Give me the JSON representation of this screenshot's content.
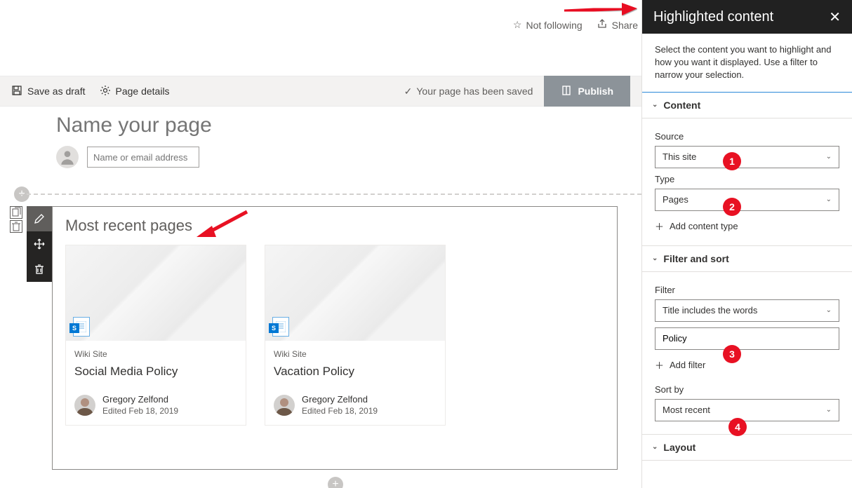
{
  "topbar": {
    "follow": "Not following",
    "share": "Share"
  },
  "commandbar": {
    "save_draft": "Save as draft",
    "page_details": "Page details",
    "saved_msg": "Your page has been saved",
    "publish": "Publish"
  },
  "page": {
    "title_placeholder": "Name your page",
    "author_placeholder": "Name or email address"
  },
  "webpart": {
    "title": "Most recent pages",
    "cards": [
      {
        "site": "Wiki Site",
        "title": "Social Media Policy",
        "author": "Gregory Zelfond",
        "meta": "Edited Feb 18, 2019"
      },
      {
        "site": "Wiki Site",
        "title": "Vacation Policy",
        "author": "Gregory Zelfond",
        "meta": "Edited Feb 18, 2019"
      }
    ]
  },
  "panel": {
    "title": "Highlighted content",
    "desc": "Select the content you want to highlight and how you want it displayed. Use a filter to narrow your selection.",
    "sections": {
      "content": {
        "label": "Content",
        "source_label": "Source",
        "source_value": "This site",
        "type_label": "Type",
        "type_value": "Pages",
        "add_type": "Add content type"
      },
      "filter": {
        "label": "Filter and sort",
        "filter_label": "Filter",
        "filter_value": "Title includes the words",
        "filter_text": "Policy",
        "add_filter": "Add filter",
        "sort_label": "Sort by",
        "sort_value": "Most recent"
      },
      "layout": {
        "label": "Layout"
      }
    }
  },
  "badges": [
    "1",
    "2",
    "3",
    "4"
  ]
}
